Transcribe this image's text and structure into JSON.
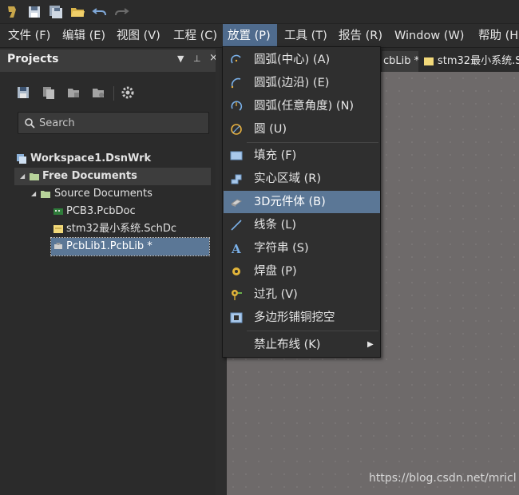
{
  "menubar": {
    "items": [
      {
        "label": "文件 (F)"
      },
      {
        "label": "编辑 (E)"
      },
      {
        "label": "视图 (V)"
      },
      {
        "label": "工程 (C)"
      },
      {
        "label": "放置 (P)"
      },
      {
        "label": "工具 (T)"
      },
      {
        "label": "报告 (R)"
      },
      {
        "label": "Window (W)"
      },
      {
        "label": "帮助 (H"
      }
    ]
  },
  "projects_panel": {
    "title": "Projects",
    "search_placeholder": "Search",
    "tree": {
      "workspace": "Workspace1.DsnWrk",
      "free_documents": "Free Documents",
      "source_documents": "Source Documents",
      "files": [
        "PCB3.PcbDoc",
        "stm32最小系统.SchDc",
        "PcbLib1.PcbLib *"
      ]
    }
  },
  "tabs": [
    "cbLib *",
    "stm32最小系统.S"
  ],
  "place_menu": {
    "items": [
      {
        "label": "圆弧(中心) (A)",
        "icon": "arc-center-icon"
      },
      {
        "label": "圆弧(边沿) (E)",
        "icon": "arc-edge-icon"
      },
      {
        "label": "圆弧(任意角度) (N)",
        "icon": "arc-any-angle-icon"
      },
      {
        "label": "圆 (U)",
        "icon": "circle-icon"
      },
      {
        "label": "填充 (F)",
        "icon": "fill-icon"
      },
      {
        "label": "实心区域 (R)",
        "icon": "solid-region-icon"
      },
      {
        "label": "3D元件体 (B)",
        "icon": "3d-body-icon"
      },
      {
        "label": "线条 (L)",
        "icon": "line-icon"
      },
      {
        "label": "字符串 (S)",
        "icon": "string-icon"
      },
      {
        "label": "焊盘 (P)",
        "icon": "pad-icon"
      },
      {
        "label": "过孔 (V)",
        "icon": "via-icon"
      },
      {
        "label": "多边形铺铜挖空",
        "icon": "polygon-cutout-icon"
      },
      {
        "label": "禁止布线 (K)",
        "icon": ""
      }
    ],
    "highlighted": "3D元件体 (B)"
  },
  "watermark": "https://blog.csdn.net/mricl",
  "colors": {
    "menu_active": "#4f6b8d",
    "menu_highlight": "#5b7796",
    "canvas": "#6e6a6a",
    "panel_bg": "#2b2b2b"
  }
}
